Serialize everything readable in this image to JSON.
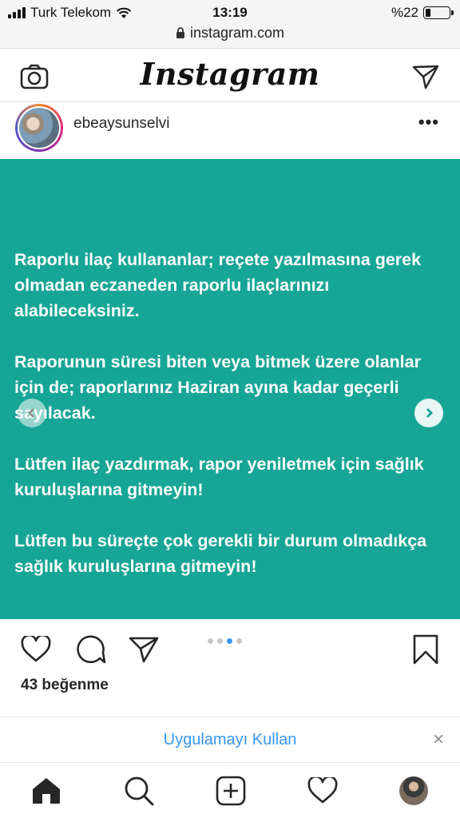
{
  "status_bar": {
    "carrier": "Turk Telekom",
    "time": "13:19",
    "battery_text": "%22",
    "battery_level": 0.22
  },
  "browser": {
    "url": "instagram.com",
    "lock_icon": "lock-icon"
  },
  "header": {
    "logo": "Instagram",
    "left_icon": "camera-icon",
    "right_icon": "direct-message-icon"
  },
  "post": {
    "username": "ebeaysunselvi",
    "more_label": "•••",
    "media_background": "#17a596",
    "paragraphs": [
      "Raporlu ilaç kullananlar; reçete yazılmasına gerek olmadan eczaneden raporlu ilaçlarınızı alabileceksiniz.",
      "Raporunun süresi biten veya bitmek üzere olanlar için de; raporlarınız Haziran ayına kadar geçerli sayılacak.",
      "Lütfen ilaç yazdırmak, rapor yeniletmek için sağlık kuruluşlarına gitmeyin!",
      "Lütfen bu süreçte çok gerekli bir durum olmadıkça sağlık kuruluşlarına gitmeyin!"
    ],
    "carousel": {
      "total": 4,
      "active_index": 2
    },
    "likes": "43 beğenme"
  },
  "app_banner": {
    "label": "Uygulamayı Kullan",
    "close": "×"
  },
  "colors": {
    "accent_blue": "#3897f0",
    "post_teal": "#17a596"
  },
  "bottom_nav": [
    "home-icon",
    "search-icon",
    "new-post-icon",
    "activity-icon",
    "profile-avatar"
  ]
}
